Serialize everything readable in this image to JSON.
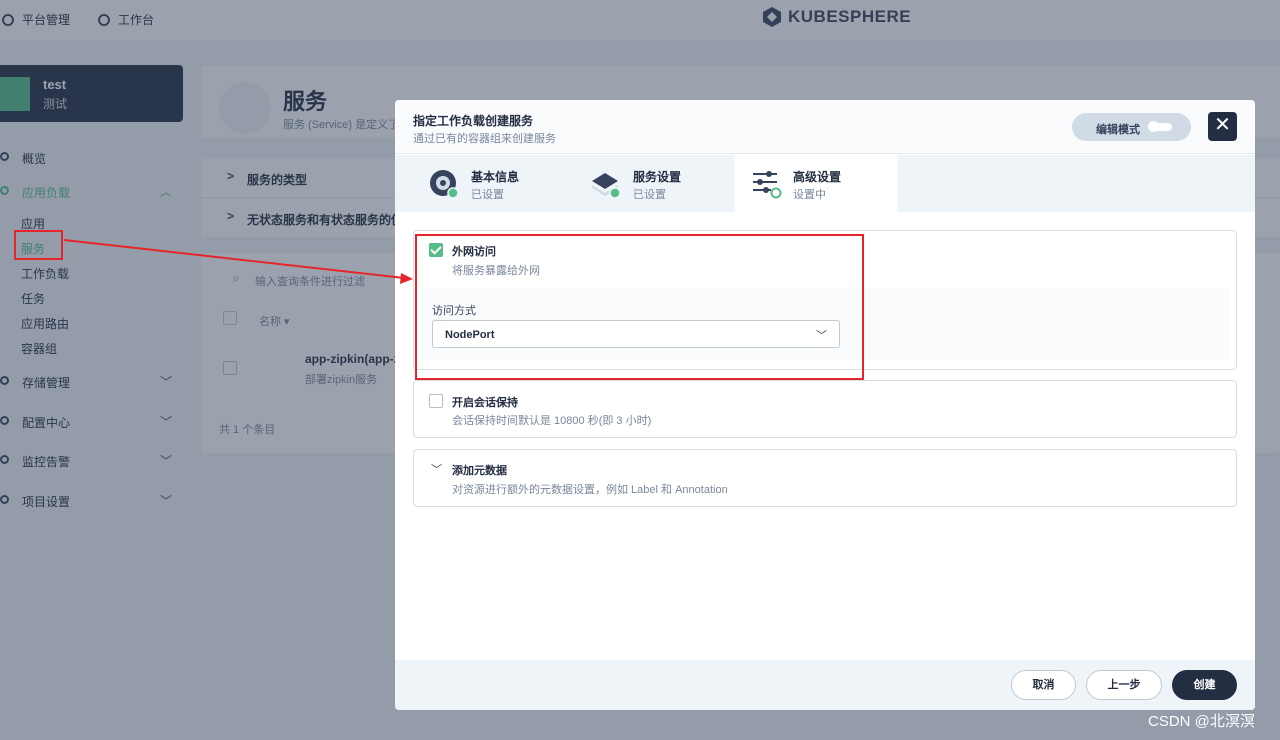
{
  "background": {
    "topbar": {
      "platform": "平台管理",
      "workbench": "工作台",
      "brand": "KUBESPHERE"
    },
    "workspace": {
      "name": "test",
      "alias": "测试"
    },
    "sidebar": {
      "overview": "概览",
      "app_workloads": "应用负载",
      "sub_items": [
        "应用",
        "服务",
        "工作负载",
        "任务",
        "应用路由",
        "容器组"
      ],
      "storage": "存储管理",
      "config": "配置中心",
      "monitoring": "监控告警",
      "project_settings": "项目设置"
    },
    "page": {
      "title": "服务",
      "description": "服务 (Service) 是定义了",
      "section1": "服务的类型",
      "section2": "无状态服务和有状态服务的使用"
    },
    "list": {
      "search_placeholder": "输入查询条件进行过滤",
      "column_name": "名称",
      "row_name": "app-zipkin(app-zip",
      "row_desc": "部署zipkin服务",
      "total": "共 1 个条目"
    }
  },
  "modal": {
    "title": "指定工作负载创建服务",
    "subtitle": "通过已有的容器组来创建服务",
    "edit_mode": "编辑模式",
    "close": "✕",
    "steps": [
      {
        "name": "基本信息",
        "status": "已设置"
      },
      {
        "name": "服务设置",
        "status": "已设置"
      },
      {
        "name": "高级设置",
        "status": "设置中"
      }
    ],
    "external_access": {
      "checked": true,
      "title": "外网访问",
      "desc": "将服务暴露给外网",
      "method_label": "访问方式",
      "method_value": "NodePort"
    },
    "session_affinity": {
      "checked": false,
      "title": "开启会话保持",
      "desc": "会话保持时间默认是 10800 秒(即 3 小时)"
    },
    "metadata": {
      "title": "添加元数据",
      "desc": "对资源进行额外的元数据设置，例如 Label 和 Annotation"
    },
    "buttons": {
      "cancel": "取消",
      "prev": "上一步",
      "create": "创建"
    }
  },
  "watermark": "CSDN @北溟溟",
  "colors": {
    "accent": "#55bc8a",
    "dark": "#242e42",
    "annotation": "#e4252a"
  }
}
